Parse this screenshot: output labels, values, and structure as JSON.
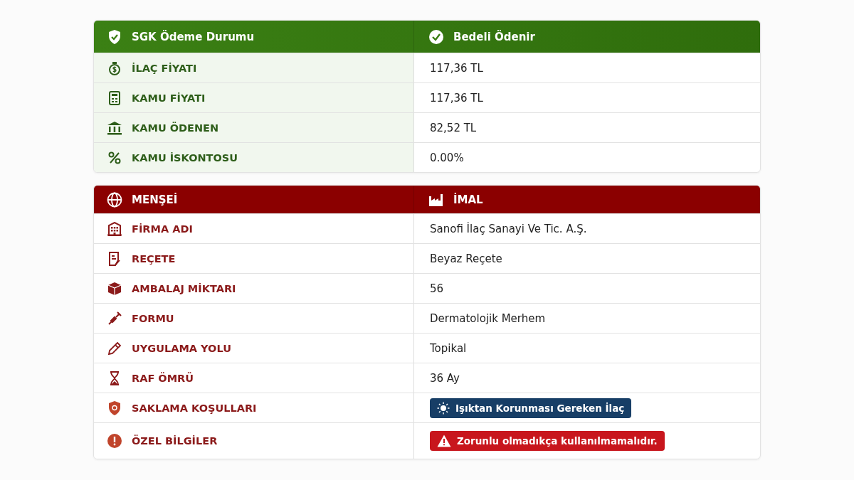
{
  "sections": [
    {
      "kind": "payment",
      "header": {
        "label": "SGK Ödeme Durumu",
        "value": "Bedeli Ödenir"
      },
      "rows": [
        {
          "label": "İLAÇ FİYATI",
          "value": "117,36 TL",
          "kind": "text"
        },
        {
          "label": "KAMU FİYATI",
          "value": "117,36 TL",
          "kind": "text"
        },
        {
          "label": "KAMU ÖDENEN",
          "value": "82,52 TL",
          "kind": "text"
        },
        {
          "label": "KAMU İSKONTOSU",
          "value": "0.00%",
          "kind": "text"
        }
      ]
    },
    {
      "kind": "origin",
      "header": {
        "label": "MENŞEİ",
        "value": "İMAL"
      },
      "rows": [
        {
          "label": "FİRMA ADI",
          "value": "Sanofi İlaç Sanayi Ve Tic. A.Ş.",
          "kind": "text"
        },
        {
          "label": "REÇETE",
          "value": "Beyaz Reçete",
          "kind": "text"
        },
        {
          "label": "AMBALAJ MİKTARI",
          "value": "56",
          "kind": "text"
        },
        {
          "label": "FORMU",
          "value": "Dermatolojik Merhem",
          "kind": "text"
        },
        {
          "label": "UYGULAMA YOLU",
          "value": "Topikal",
          "kind": "text"
        },
        {
          "label": "RAF ÖMRÜ",
          "value": "36 Ay",
          "kind": "text"
        },
        {
          "label": "SAKLAMA KOŞULLARI",
          "value": "Işıktan Korunması Gereken İlaç",
          "kind": "info-badge"
        },
        {
          "label": "ÖZEL BİLGİLER",
          "value": "Zorunlu olmadıkça kullanılmamalıdır.",
          "kind": "warning-badge"
        }
      ]
    }
  ]
}
